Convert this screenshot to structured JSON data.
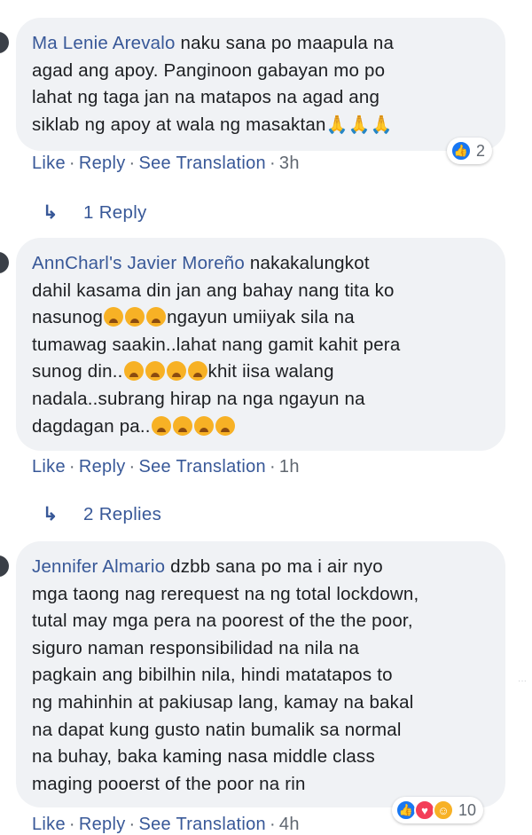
{
  "comments": [
    {
      "author": "Ma Lenie Arevalo",
      "lines": [
        "naku sana po maapula na",
        "agad ang apoy. Panginoon gabayan mo po",
        "lahat ng taga jan na matapos na agad ang",
        "siklab ng apoy at wala ng masaktan"
      ],
      "emoji_suffix": "🙏🙏🙏",
      "actions": {
        "like": "Like",
        "reply": "Reply",
        "translate": "See Translation",
        "time": "3h"
      },
      "reaction_count": "2",
      "replies_label": "1 Reply"
    },
    {
      "author": "AnnCharl's Javier Moreño",
      "lines": [
        "nakakalungkot",
        "dahil kasama din jan ang bahay nang tita ko",
        "nasunog",
        "ngayun umiiyak sila na",
        "tumawag saakin..lahat nang gamit kahit pera",
        "sunog din..",
        "khit iisa walang",
        "nadala..subrang hirap na nga ngayun na",
        "dagdagan pa.."
      ],
      "actions": {
        "like": "Like",
        "reply": "Reply",
        "translate": "See Translation",
        "time": "1h"
      },
      "replies_label": "2 Replies"
    },
    {
      "author": "Jennifer Almario",
      "lines": [
        "dzbb sana po ma i air nyo",
        "mga taong nag rerequest na ng total lockdown,",
        "tutal may mga pera na poorest of the the poor,",
        "siguro naman responsibilidad na nila na",
        "pagkain ang bibilhin nila, hindi matatapos to",
        "ng mahinhin at pakiusap lang, kamay na bakal",
        "na dapat kung gusto natin bumalik sa normal",
        "na buhay, baka kaming nasa middle class",
        "maging pooerst of the poor na rin"
      ],
      "actions": {
        "like": "Like",
        "reply": "Reply",
        "translate": "See Translation",
        "time": "4h"
      },
      "reaction_count": "10"
    }
  ],
  "separator": "·",
  "icons": {
    "reply_arrow": "reply-arrow-icon",
    "like": "like-reaction-icon",
    "love": "love-reaction-icon",
    "haha": "haha-reaction-icon",
    "crying": "crying-face-emoji"
  },
  "colors": {
    "link": "#385898",
    "bubble": "#f0f2f5",
    "meta": "#606770",
    "like_blue": "#1877f2"
  }
}
